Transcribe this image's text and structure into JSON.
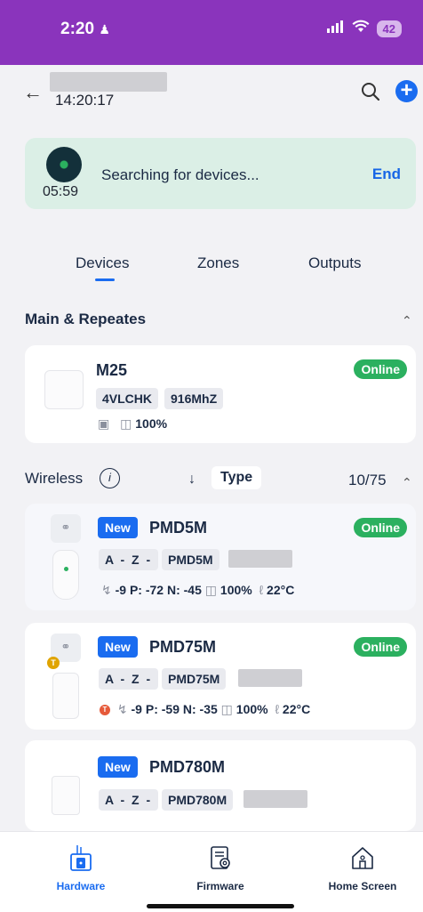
{
  "status_bar": {
    "time": "2:20",
    "battery": "42"
  },
  "header": {
    "clock": "14:20:17"
  },
  "search": {
    "timer": "05:59",
    "message": "Searching for devices...",
    "end_label": "End"
  },
  "tabs": [
    {
      "label": "Devices"
    },
    {
      "label": "Zones"
    },
    {
      "label": "Outputs"
    }
  ],
  "main_section": {
    "title": "Main & Repeates",
    "device": {
      "name": "M25",
      "id": "4VLCHK",
      "freq": "916MhZ",
      "battery": "100%",
      "status": "Online"
    }
  },
  "wireless": {
    "title": "Wireless",
    "sort_label": "Type",
    "count": "10/75",
    "devices": [
      {
        "badge": "New",
        "name": "PMD5M",
        "chips": [
          "A",
          "-",
          "Z",
          "-",
          "PMD5M"
        ],
        "signal": "-9",
        "p": "P: -72",
        "n": "N: -45",
        "battery": "100%",
        "temp": "22°C",
        "status": "Online"
      },
      {
        "badge": "New",
        "name": "PMD75M",
        "chips": [
          "A",
          "-",
          "Z",
          "-",
          "PMD75M"
        ],
        "signal": "-9",
        "p": "P: -59",
        "n": "N: -35",
        "battery": "100%",
        "temp": "22°C",
        "status": "Online"
      },
      {
        "badge": "New",
        "name": "PMD780M",
        "chips": [
          "A",
          "-",
          "Z",
          "-",
          "PMD780M"
        ]
      }
    ]
  },
  "bottom_nav": [
    {
      "label": "Hardware",
      "active": true
    },
    {
      "label": "Firmware",
      "active": false
    },
    {
      "label": "Home Screen",
      "active": false
    }
  ],
  "colors": {
    "accent": "#1a6cf0",
    "status_bar": "#8a34bc",
    "online": "#2bb05f",
    "banner": "#dbefe6"
  }
}
